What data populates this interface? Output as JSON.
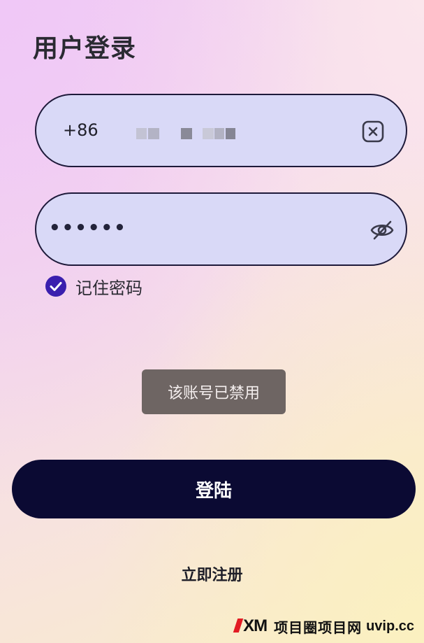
{
  "header": {
    "title": "用户登录"
  },
  "phone_field": {
    "country_code": "+86",
    "value": "",
    "clear_icon": "clear-x-square-icon"
  },
  "password_field": {
    "value": "••••••",
    "visibility_icon": "eye-off-icon"
  },
  "remember": {
    "label": "记住密码",
    "checked": true,
    "check_color": "#3a1fae"
  },
  "toast": {
    "message": "该账号已禁用"
  },
  "login_button": {
    "label": "登陆",
    "color": "#0b0a33"
  },
  "register_link": {
    "label": "立即注册"
  },
  "watermark": {
    "logo": "XM",
    "text": "项目圈项目网",
    "url": "uvip.cc"
  }
}
